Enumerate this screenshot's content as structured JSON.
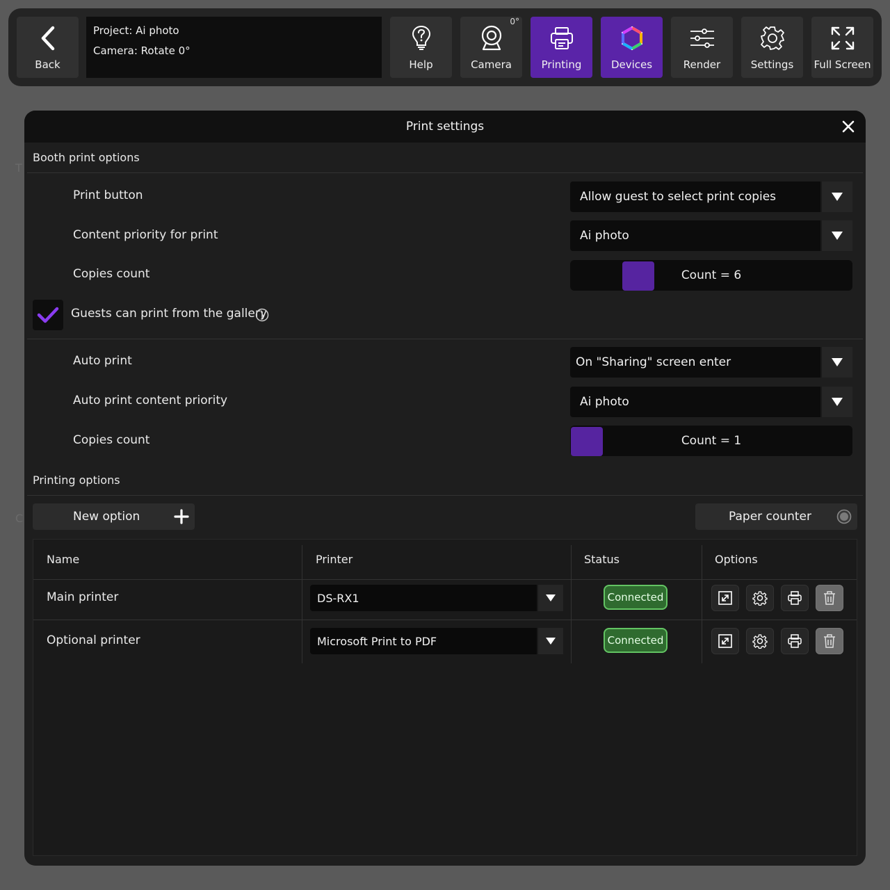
{
  "toolbar": {
    "back": {
      "label": "Back",
      "icon": "chevron-left-icon"
    },
    "project_line": "Project: Ai photo",
    "camera_line": "Camera: Rotate 0°",
    "buttons": [
      {
        "label": "Help",
        "icon": "lightbulb-question-icon"
      },
      {
        "label": "Camera",
        "icon": "webcam-icon",
        "badge": "0°"
      },
      {
        "label": "Printing",
        "icon": "printer-icon",
        "active": true
      },
      {
        "label": "Devices",
        "icon": "hexagon-ring-icon",
        "active": true
      },
      {
        "label": "Render",
        "icon": "sliders-icon"
      },
      {
        "label": "Settings",
        "icon": "gear-icon"
      },
      {
        "label": "Full Screen",
        "icon": "expand-icon"
      }
    ],
    "active_color": "#5a24a8"
  },
  "modal": {
    "title": "Print settings",
    "booth_section": "Booth print options",
    "print_button_label": "Print button",
    "print_button_value": "Allow guest to select print copies",
    "content_priority_label": "Content priority for print",
    "content_priority_value": "Ai photo",
    "copies_label": "Copies count",
    "copies_value": "Count = 6",
    "copies_number": 6,
    "gallery_label": "Guests can print from the gallery",
    "gallery_checked": true,
    "auto_print_label": "Auto print",
    "auto_print_value": "On \"Sharing\" screen enter",
    "auto_priority_label": "Auto print content priority",
    "auto_priority_value": "Ai photo",
    "auto_copies_label": "Copies count",
    "auto_copies_value": "Count = 1",
    "auto_copies_number": 1,
    "printing_section": "Printing options",
    "new_option_label": "New option",
    "paper_counter_label": "Paper counter"
  },
  "table": {
    "headers": {
      "name": "Name",
      "printer": "Printer",
      "status": "Status",
      "options": "Options"
    },
    "rows": [
      {
        "name": "Main printer",
        "printer": "DS-RX1",
        "status": "Connected"
      },
      {
        "name": "Optional printer",
        "printer": "Microsoft Print to PDF",
        "status": "Connected"
      }
    ],
    "status_color": "#63c463"
  },
  "accent_color": "#5624a0"
}
